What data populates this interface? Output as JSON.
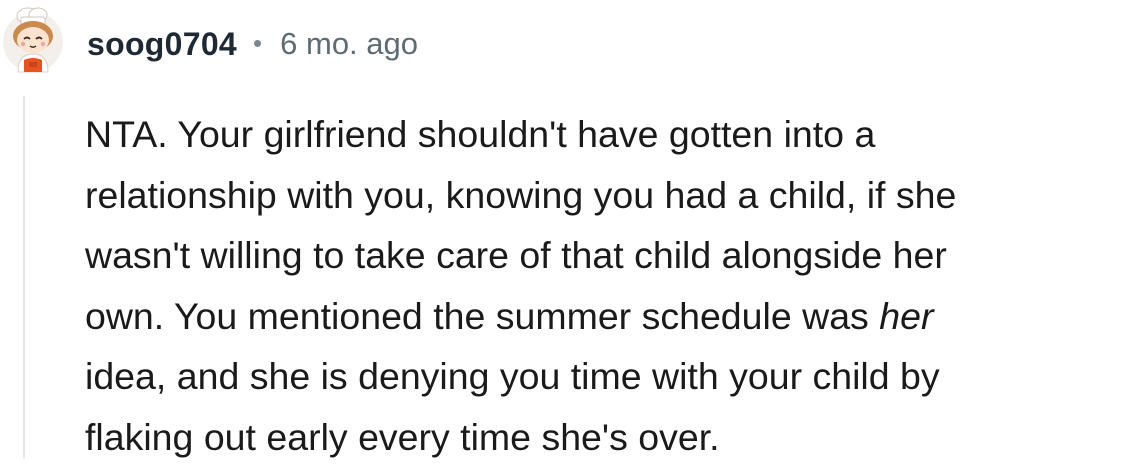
{
  "comment": {
    "username": "soog0704",
    "separator": "•",
    "timestamp": "6 mo. ago",
    "avatar_icon": "snoo-chef-avatar-icon",
    "body": {
      "line1": "NTA. Your girlfriend shouldn't have gotten into a",
      "line2": "relationship with you, knowing you had a child, if she",
      "line3": "wasn't willing to take care of that child alongside her",
      "line4_before": "own. You mentioned the summer schedule was ",
      "line4_emphasis": "her",
      "line5": "idea, and she is denying you time with your child by",
      "line6": "flaking out early every time she's over."
    }
  },
  "colors": {
    "username": "#1f2933",
    "timestamp": "#5f6b73",
    "body_text": "#1a1a1a",
    "thread_line": "#e5e7eb",
    "avatar_background": "#f3f0ec",
    "avatar_apron": "#e8531f"
  }
}
